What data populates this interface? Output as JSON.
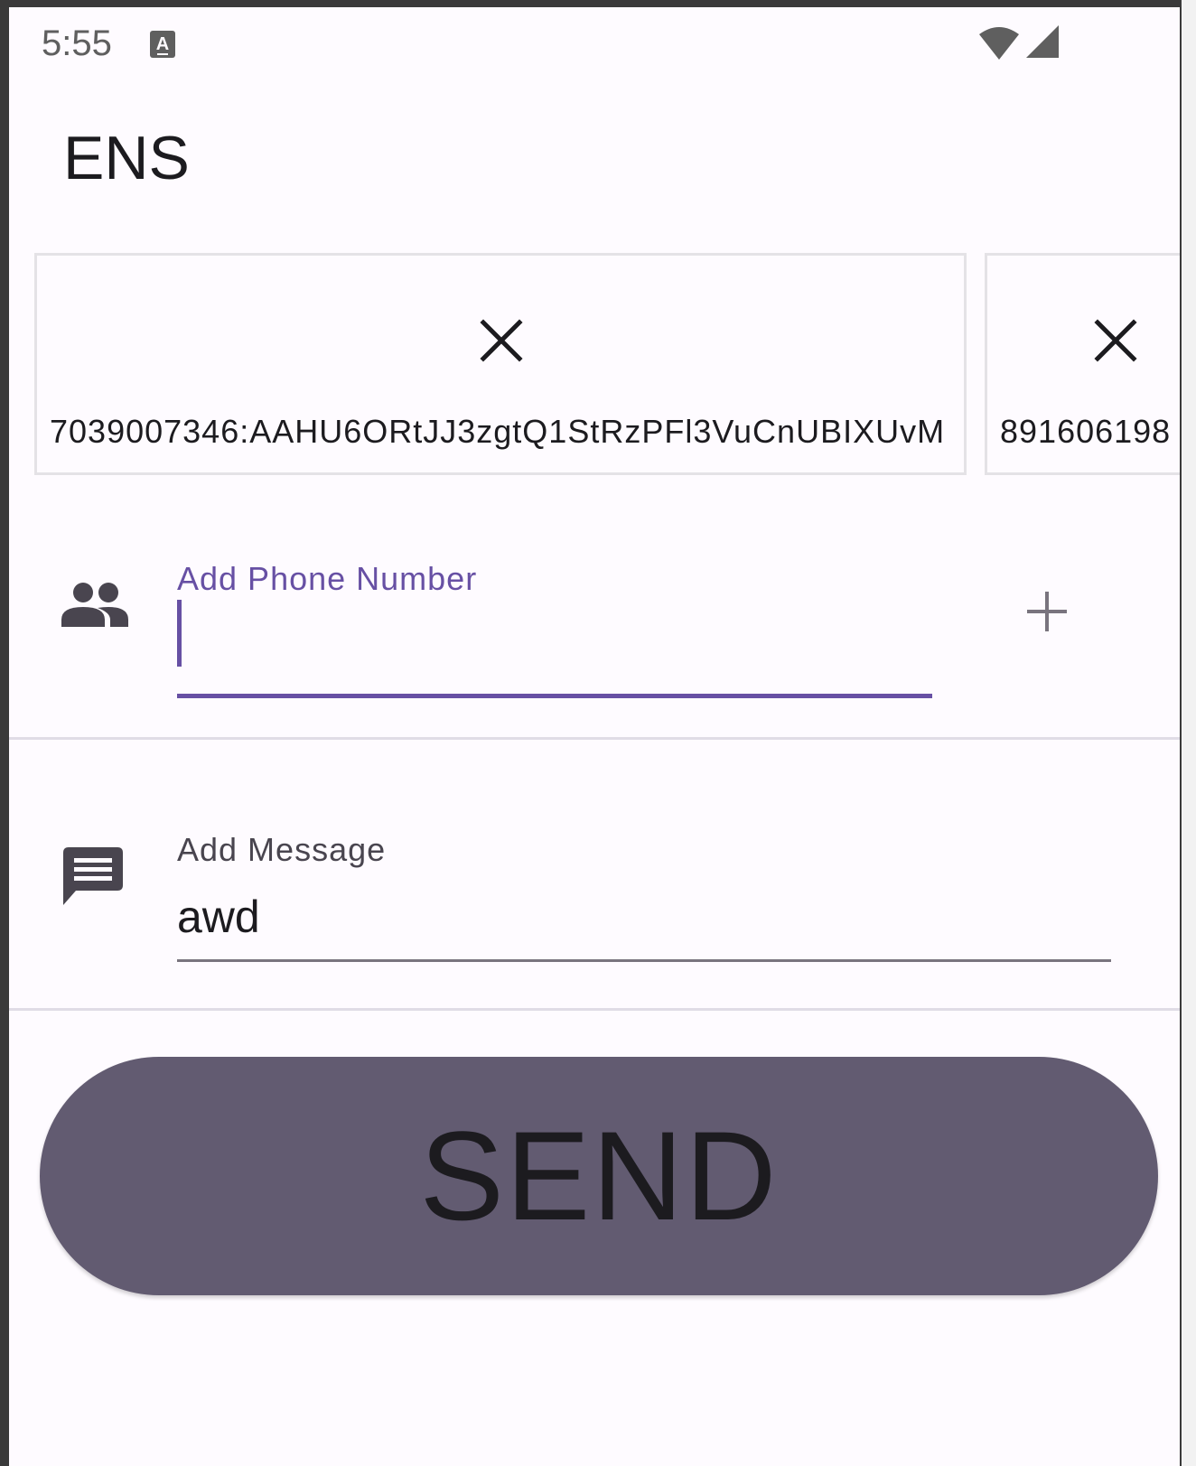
{
  "status_bar": {
    "time": "5:55",
    "notification_icon": "a-letter-icon",
    "wifi_icon": "wifi-icon",
    "signal_icon": "cell-signal-icon"
  },
  "app_bar": {
    "title": "ENS"
  },
  "tokens": [
    {
      "value": "7039007346:AAHU6ORtJJ3zgtQ1StRzPFl3VuCnUBIXUvM",
      "remove_icon": "close-icon"
    },
    {
      "value": "891606198",
      "remove_icon": "close-icon"
    }
  ],
  "phone_field": {
    "icon": "people-icon",
    "label": "Add Phone Number",
    "value": "",
    "add_icon": "plus-icon"
  },
  "message_field": {
    "icon": "message-icon",
    "label": "Add Message",
    "value": "awd"
  },
  "send_button": {
    "label": "SEND"
  },
  "colors": {
    "primary": "#6750a4",
    "send_button": "#625b71",
    "background": "#fefbff",
    "text": "#1c1b1f"
  }
}
